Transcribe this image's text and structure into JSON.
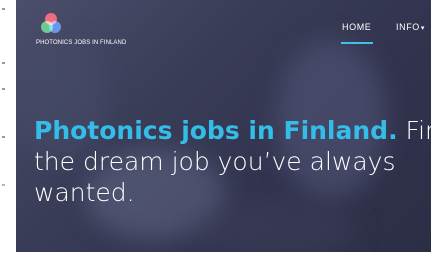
{
  "brand": {
    "logo_text": "PHOTONICS JOBS IN FINLAND",
    "logo_icon": "rgb-circles-logo"
  },
  "nav": {
    "items": [
      {
        "label": "HOME",
        "active": true
      },
      {
        "label": "INFO",
        "dropdown": true
      }
    ]
  },
  "hero": {
    "headline_accent": "Photonics jobs in Finland.",
    "headline_rest_1": " Find",
    "headline_line_2": "the dream job you’ve always",
    "headline_line_3": "wanted."
  },
  "colors": {
    "accent": "#35bde9",
    "nav_underline": "#3ec1ea",
    "text": "#ffffff"
  }
}
